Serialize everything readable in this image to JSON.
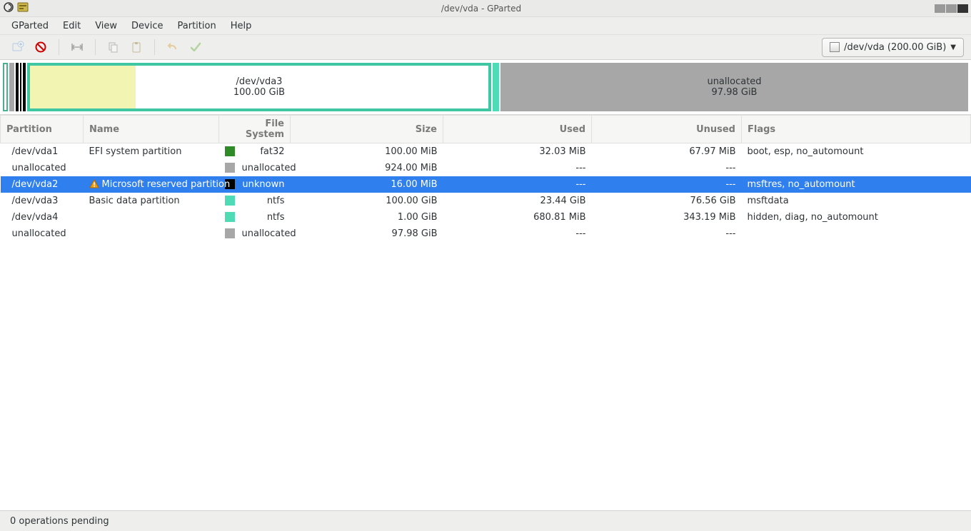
{
  "title": "/dev/vda - GParted",
  "menu": {
    "gparted": "GParted",
    "edit": "Edit",
    "view": "View",
    "device": "Device",
    "partition": "Partition",
    "help": "Help"
  },
  "toolbar": {
    "device_label": "/dev/vda (200.00 GiB)",
    "icons": {
      "new": "new-partition-icon",
      "delete": "delete-partition-icon",
      "resize": "resize-move-icon",
      "copy": "copy-icon",
      "paste": "paste-icon",
      "undo": "undo-icon",
      "apply": "apply-icon"
    }
  },
  "graph": {
    "vda3": {
      "label": "/dev/vda3",
      "size": "100.00 GiB"
    },
    "unalloc": {
      "label": "unallocated",
      "size": "97.98 GiB"
    }
  },
  "table": {
    "headers": {
      "partition": "Partition",
      "name": "Name",
      "fs": "File System",
      "size": "Size",
      "used": "Used",
      "unused": "Unused",
      "flags": "Flags"
    },
    "rows": [
      {
        "partition": "/dev/vda1",
        "name": "EFI system partition",
        "fs": "fat32",
        "fs_class": "sw-fat32",
        "size": "100.00 MiB",
        "used": "32.03 MiB",
        "unused": "67.97 MiB",
        "flags": "boot, esp, no_automount",
        "warn": false,
        "selected": false
      },
      {
        "partition": "unallocated",
        "name": "",
        "fs": "unallocated",
        "fs_class": "sw-unalloc",
        "size": "924.00 MiB",
        "used": "---",
        "unused": "---",
        "flags": "",
        "warn": false,
        "selected": false
      },
      {
        "partition": "/dev/vda2",
        "name": "Microsoft reserved partition",
        "fs": "unknown",
        "fs_class": "sw-unknown",
        "size": "16.00 MiB",
        "used": "---",
        "unused": "---",
        "flags": "msftres, no_automount",
        "warn": true,
        "selected": true
      },
      {
        "partition": "/dev/vda3",
        "name": "Basic data partition",
        "fs": "ntfs",
        "fs_class": "sw-ntfs",
        "size": "100.00 GiB",
        "used": "23.44 GiB",
        "unused": "76.56 GiB",
        "flags": "msftdata",
        "warn": false,
        "selected": false
      },
      {
        "partition": "/dev/vda4",
        "name": "",
        "fs": "ntfs",
        "fs_class": "sw-ntfs",
        "size": "1.00 GiB",
        "used": "680.81 MiB",
        "unused": "343.19 MiB",
        "flags": "hidden, diag, no_automount",
        "warn": false,
        "selected": false
      },
      {
        "partition": "unallocated",
        "name": "",
        "fs": "unallocated",
        "fs_class": "sw-unalloc",
        "size": "97.98 GiB",
        "used": "---",
        "unused": "---",
        "flags": "",
        "warn": false,
        "selected": false
      }
    ]
  },
  "status": "0 operations pending"
}
